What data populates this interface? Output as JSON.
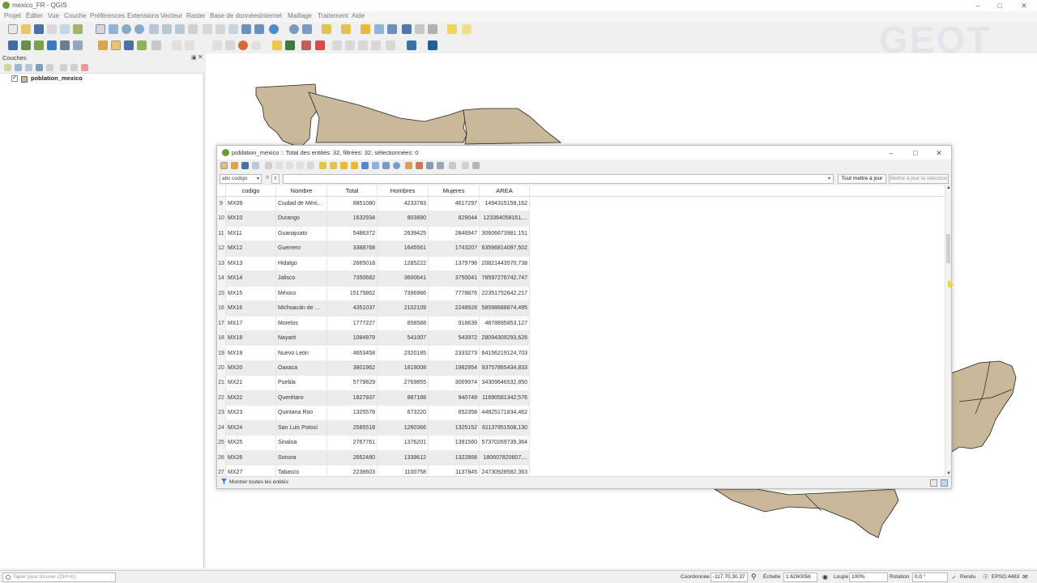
{
  "window": {
    "title": "mexico_FR - QGIS",
    "controls": [
      "–",
      "□",
      "✕"
    ]
  },
  "menu": [
    "Projet",
    "Éditer",
    "Vue",
    "Couche",
    "Préférences",
    "Extensions",
    "Vecteur",
    "Raster",
    "Base de données",
    "Internet",
    "Maillage",
    "Traitement",
    "Aide"
  ],
  "layers_panel": {
    "title": "Couches",
    "layer": {
      "name": "poblation_mexico",
      "checked": "✓"
    }
  },
  "watermark": "GEOT",
  "dialog": {
    "title": "poblation_mexico :: Total des entités: 32, filtrées: 32, sélectionnées: 0",
    "field": "abc codigo",
    "eq": "=",
    "expr": "ε",
    "update_all": "Tout mettre à jour",
    "update_sel": "Mettre à jour la sélection",
    "show_all": "Montrer toutes les entités",
    "columns": [
      "codigo",
      "Nombre",
      "Total",
      "Hombres",
      "Mujeres",
      "AREA"
    ],
    "rows": [
      [
        "9",
        "MX09",
        "Ciudad de Méxi...",
        "8851080",
        "4233783",
        "4617297",
        "1494315159,162"
      ],
      [
        "10",
        "MX10",
        "Durango",
        "1632934",
        "803890",
        "829044",
        "123364058161,..."
      ],
      [
        "11",
        "MX11",
        "Guanajuato",
        "5486372",
        "2639425",
        "2846947",
        "30606673981,151"
      ],
      [
        "12",
        "MX12",
        "Guerrero",
        "3388768",
        "1645561",
        "1743207",
        "63596814097,502"
      ],
      [
        "13",
        "MX13",
        "Hidalgo",
        "2665018",
        "1285222",
        "1379796",
        "20821443570,738"
      ],
      [
        "14",
        "MX14",
        "Jalisco",
        "7350682",
        "3600641",
        "3750041",
        "78597276742,747"
      ],
      [
        "15",
        "MX15",
        "México",
        "15175862",
        "7396986",
        "7778876",
        "22351752642,217"
      ],
      [
        "16",
        "MX16",
        "Michoacán de ...",
        "4351037",
        "2102109",
        "2248928",
        "58598688874,495"
      ],
      [
        "17",
        "MX17",
        "Morelos",
        "1777227",
        "858588",
        "918639",
        "4878895853,127"
      ],
      [
        "18",
        "MX18",
        "Nayarit",
        "1084979",
        "541007",
        "543972",
        "28094309293,626"
      ],
      [
        "19",
        "MX19",
        "Nuevo León",
        "4653458",
        "2320185",
        "2333273",
        "64156219124,703"
      ],
      [
        "20",
        "MX20",
        "Oaxaca",
        "3801962",
        "1819008",
        "1982954",
        "93757865434,833"
      ],
      [
        "21",
        "MX21",
        "Puebla",
        "5779829",
        "2769855",
        "3009974",
        "34309646532,850"
      ],
      [
        "22",
        "MX22",
        "Querétaro",
        "1827937",
        "887188",
        "940749",
        "11690581342,576"
      ],
      [
        "23",
        "MX23",
        "Quintana Roo",
        "1325578",
        "673220",
        "652358",
        "44825171834,462"
      ],
      [
        "24",
        "MX24",
        "San Luis Potosí",
        "2585518",
        "1260366",
        "1325152",
        "61137951508,130"
      ],
      [
        "25",
        "MX25",
        "Sinaloa",
        "2767761",
        "1376201",
        "1391560",
        "57370269739,364"
      ],
      [
        "26",
        "MX26",
        "Sonora",
        "2662480",
        "1339612",
        "1322868",
        "180607820607,..."
      ],
      [
        "27",
        "MX27",
        "Tabasco",
        "2238603",
        "1100758",
        "1137845",
        "24730928582,363"
      ]
    ]
  },
  "status": {
    "locator_placeholder": "Taper pour trouver (Ctrl+K)",
    "coord_label": "Coordonnée",
    "coord_value": "-117.70,30.37",
    "scale_label": "Échelle",
    "scale_value": "1:6260056",
    "zoom_label": "Loupe",
    "zoom_value": "100%",
    "rotation_label": "Rotation",
    "rotation_value": "0,0 °",
    "render_label": "Rendu",
    "crs": "EPSG:4483"
  },
  "colors": {
    "polygon_fill": "#c9b99a",
    "polygon_stroke": "#222222",
    "row_alt": "#ececec",
    "qgis_green": "#6a9c34"
  }
}
